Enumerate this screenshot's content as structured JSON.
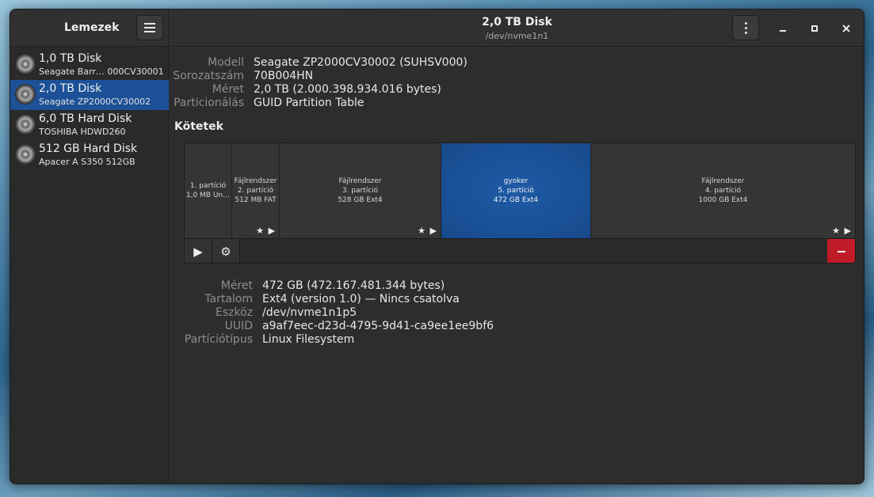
{
  "app": {
    "title": "Lemezek"
  },
  "header": {
    "title": "2,0 TB Disk",
    "subtitle": "/dev/nvme1n1"
  },
  "sidebar": {
    "items": [
      {
        "name": "1,0 TB Disk",
        "model": "Seagate Barr… 000CV30001",
        "selected": false
      },
      {
        "name": "2,0 TB Disk",
        "model": "Seagate ZP2000CV30002",
        "selected": true
      },
      {
        "name": "6,0 TB Hard Disk",
        "model": "TOSHIBA HDWD260",
        "selected": false
      },
      {
        "name": "512 GB Hard Disk",
        "model": "Apacer A S350 512GB",
        "selected": false
      }
    ]
  },
  "drive": {
    "labels": {
      "model": "Modell",
      "serial": "Sorozatszám",
      "size": "Méret",
      "partitioning": "Particionálás"
    },
    "values": {
      "model": "Seagate ZP2000CV30002 (SUHSV000)",
      "serial": "70B004HN",
      "size": "2,0 TB (2.000.398.934.016 bytes)",
      "partitioning": "GUID Partition Table"
    }
  },
  "volumes": {
    "title": "Kötetek",
    "partitions": [
      {
        "line1": "1. partíció",
        "line2": "1,0 MB Un…",
        "line3": "",
        "marks": "",
        "selected": false
      },
      {
        "line1": "Fájlrendszer",
        "line2": "2. partíció",
        "line3": "512 MB FAT",
        "marks": "★ ▶",
        "selected": false
      },
      {
        "line1": "Fájlrendszer",
        "line2": "3. partíció",
        "line3": "528 GB Ext4",
        "marks": "★ ▶",
        "selected": false
      },
      {
        "line1": "gyoker",
        "line2": "5. partíció",
        "line3": "472 GB Ext4",
        "marks": "",
        "selected": true
      },
      {
        "line1": "Fájlrendszer",
        "line2": "4. partíció",
        "line3": "1000 GB Ext4",
        "marks": "★ ▶",
        "selected": false
      }
    ]
  },
  "selected_partition": {
    "labels": {
      "size": "Méret",
      "contents": "Tartalom",
      "device": "Eszköz",
      "uuid": "UUID",
      "type": "Partíciótípus"
    },
    "values": {
      "size": "472 GB (472.167.481.344 bytes)",
      "contents": "Ext4 (version 1.0) — Nincs csatolva",
      "device": "/dev/nvme1n1p5",
      "uuid": "a9af7eec-d23d-4795-9d41-ca9ee1ee9bf6",
      "type": "Linux Filesystem"
    }
  },
  "toolbar": {
    "mount_glyph": "▶",
    "settings_glyph": "⚙"
  },
  "icons": {
    "menu": "hamburger-menu-icon",
    "kebab": "vertical-dots-icon",
    "disk": "hard-disk-icon",
    "delete": "minus-icon"
  },
  "colors": {
    "selection": "#1c5197",
    "danger": "#c01c28"
  }
}
